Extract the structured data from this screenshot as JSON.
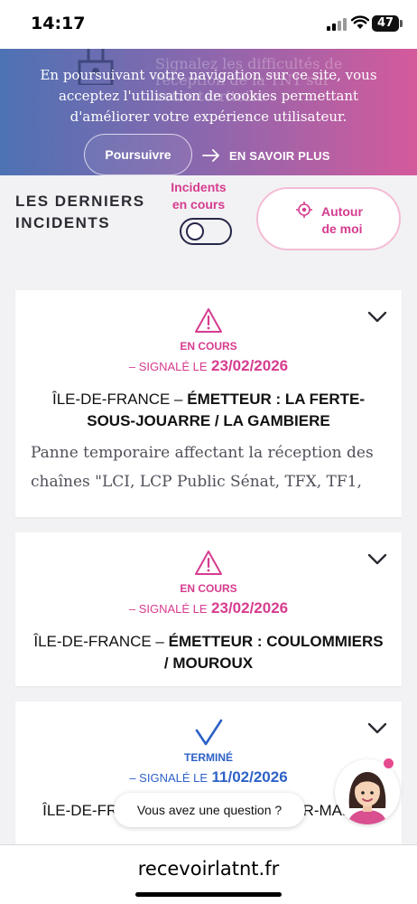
{
  "status_bar": {
    "time": "14:17",
    "battery": "47"
  },
  "cookie_banner": {
    "text": "En poursuivant votre navigation sur ce site, vous acceptez l'utilisation de cookies permettant d'améliorer votre expérience utilisateur.",
    "accept_label": "Poursuivre",
    "learn_more_label": "EN SAVOIR PLUS"
  },
  "hero_background_text": "Signalez les difficultés de réception de la TNT sur votre territoire",
  "incidents_header": {
    "title": "LES DERNIERS INCIDENTS",
    "toggle_label": "Incidents en cours",
    "nearby_label": "Autour de moi"
  },
  "incidents": [
    {
      "status": "EN COURS",
      "status_icon": "warning-icon",
      "reported_prefix": "– SIGNALÉ LE",
      "date": "23/02/2026",
      "region": "ÎLE-DE-FRANCE –",
      "transmitter": "ÉMETTEUR : LA FERTE-SOUS-JOUARRE / LA GAMBIERE",
      "description": "Panne temporaire affectant la réception des chaînes \"LCI, LCP Public Sénat, TFX, TF1,"
    },
    {
      "status": "EN COURS",
      "status_icon": "warning-icon",
      "reported_prefix": "– SIGNALÉ LE",
      "date": "23/02/2026",
      "region": "ÎLE-DE-FRANCE –",
      "transmitter": "ÉMETTEUR : COULOMMIERS / MOUROUX"
    },
    {
      "status": "TERMINÉ",
      "status_icon": "checkmark-icon",
      "reported_prefix": "– SIGNALÉ LE",
      "date": "11/02/2026",
      "title_visible": "ÎLE-DE-FR...ACY-MARNE / MERY-SUR-MARNE"
    }
  ],
  "chat": {
    "bubble_text": "Vous avez une question ?"
  },
  "browser": {
    "url": "recevoirlatnt.fr"
  },
  "colors": {
    "accent_pink": "#d63c8f",
    "accent_blue": "#2e61c7",
    "gradient_start": "#4d72b4",
    "gradient_end": "#d45a9c"
  }
}
